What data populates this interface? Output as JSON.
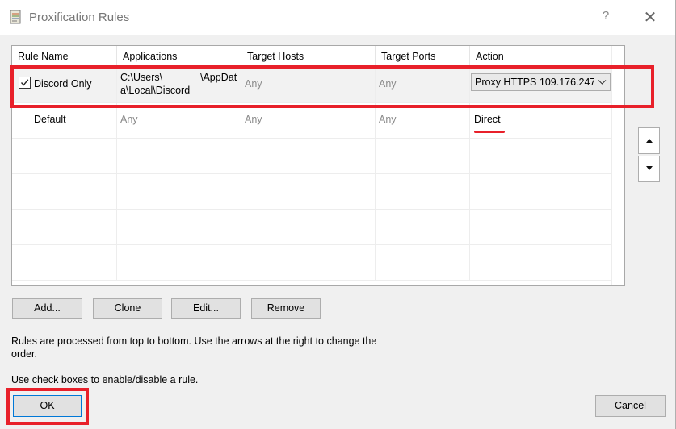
{
  "window": {
    "title": "Proxification Rules",
    "help_label": "?",
    "close_label": "✕"
  },
  "table": {
    "headers": [
      "Rule Name",
      "Applications",
      "Target Hosts",
      "Target Ports",
      "Action"
    ],
    "rows": [
      {
        "enabled": true,
        "name": "Discord Only",
        "app_line1": "C:\\Users\\",
        "app_line1_b": "\\AppDat",
        "app_line2": "a\\Local\\Discord",
        "hosts": "Any",
        "ports": "Any",
        "action": "Proxy HTTPS 109.176.247"
      },
      {
        "enabled": null,
        "name": "Default",
        "app": "Any",
        "hosts": "Any",
        "ports": "Any",
        "action": "Direct"
      }
    ]
  },
  "buttons": {
    "add": "Add...",
    "clone": "Clone",
    "edit": "Edit...",
    "remove": "Remove",
    "ok": "OK",
    "cancel": "Cancel"
  },
  "info": {
    "line1": "Rules are processed from top to bottom. Use the arrows at the right to change the",
    "line2": "order.",
    "line3": "Use check boxes to enable/disable a rule."
  },
  "icons": {
    "move_up": "triangle-up-icon",
    "move_down": "triangle-down-icon",
    "dropdown": "chevron-down-icon",
    "app": "scroll-icon"
  },
  "colors": {
    "annotation": "#e8202a",
    "window_bg": "#f0f0f0"
  }
}
